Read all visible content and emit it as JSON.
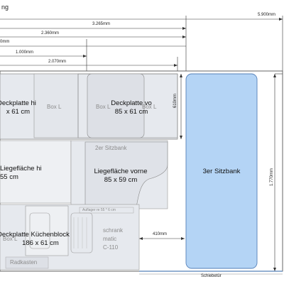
{
  "title_fragment": "ng",
  "dims": {
    "total_width": "5.900mm",
    "mid_width": "3.265mm",
    "w2360": "2.360mm",
    "w_partial": "0mm",
    "w1000": "1.000mm",
    "w2070": "2.070mm",
    "h610": "610mm",
    "h1770": "1.770mm",
    "gap410": "410mm"
  },
  "labels": {
    "deckplatte_hi": [
      "Deckplatte hi",
      "x 61 cm"
    ],
    "box_l_1": "Box L",
    "box_l_2": "Box L",
    "box_l_3": "Box L",
    "deckplatte_vo": [
      "Deckplatte vo",
      "85 x 61 cm"
    ],
    "zweite_sitzbank": "2er Sitzbank",
    "liegeflaeche_hi": [
      "Liegefläche hi",
      "55 cm"
    ],
    "liegeflaeche_vorne": [
      "Liegefläche vorne",
      "85 x 59 cm"
    ],
    "dritte_sitzbank": "3er Sitzbank",
    "deckplatte_kuechenblock": [
      "Deckplatte Küchenblock",
      "186 x 61 cm"
    ],
    "box_l_kitchen": "Box L",
    "schrank": "schrank",
    "matic": "matic",
    "c110": "C-110",
    "radkasten": "Radkasten",
    "auflager": "Auflager re 55 * 6 cm",
    "schiebetuer": "Schiebetür"
  },
  "colors": {
    "bench_fill": "#b4d4f5",
    "bench_stroke": "#5580b8",
    "panel_fill": "#e6e9ee",
    "dim_line": "#333333"
  }
}
